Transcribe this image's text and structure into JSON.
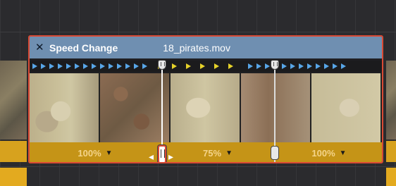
{
  "clip": {
    "close_icon": "close-icon",
    "title": "Speed Change",
    "filename": "18_pirates.mov"
  },
  "markers": {
    "left_count": 14,
    "mid_count": 6,
    "right_count": 12,
    "colors": {
      "normal": "#58a6e8",
      "change": "#e6d22a"
    }
  },
  "speed": {
    "segments": [
      {
        "label": "100%"
      },
      {
        "label": "75%"
      },
      {
        "label": "100%"
      }
    ]
  },
  "colors": {
    "clip_border": "#d94a35",
    "header": "#6f8fb1",
    "speed_bar": "#c59417"
  }
}
